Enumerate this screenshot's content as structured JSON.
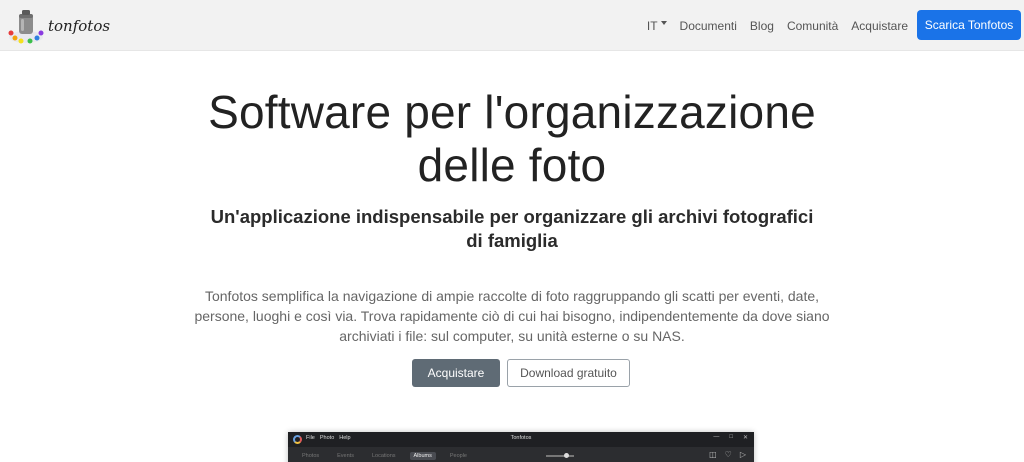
{
  "brand": {
    "name": "tonfotos",
    "logo_icon": "paint-jar-logo"
  },
  "nav": {
    "language": "IT",
    "links": [
      "Documenti",
      "Blog",
      "Comunità",
      "Acquistare"
    ],
    "cta": "Scarica Tonfotos"
  },
  "hero": {
    "title": "Software per l'organizzazione delle foto",
    "subtitle": "Un'applicazione indispensabile per organizzare gli archivi fotografici di famiglia",
    "description": "Tonfotos semplifica la navigazione di ampie raccolte di foto raggruppando gli scatti per eventi, date, persone, luoghi e così via. Trova rapidamente ciò di cui hai bisogno, indipendentemente da dove siano archiviati i file: sul computer, su unità esterne o su NAS.",
    "buy_button": "Acquistare",
    "free_button": "Download gratuito"
  },
  "app_preview": {
    "menu": [
      "File",
      "Photo",
      "Help"
    ],
    "title": "Tonfotos",
    "tabs": [
      "Photos",
      "Events",
      "Locations",
      "Albums",
      "People"
    ],
    "active_tab": "Albums"
  },
  "colors": {
    "nav_background": "#f2f2f2",
    "primary_cta": "#1a73e8",
    "buy_button": "#5f6b75"
  }
}
